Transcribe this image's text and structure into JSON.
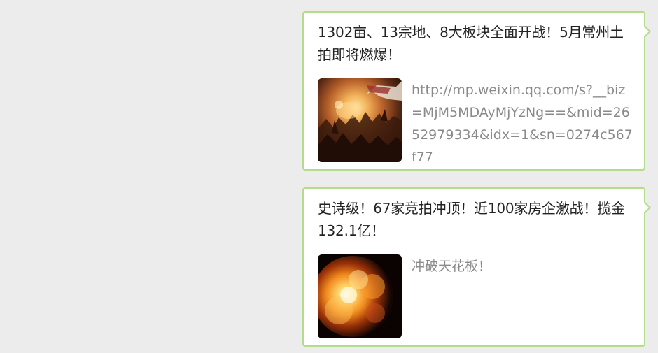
{
  "messages": [
    {
      "title": "1302亩、13宗地、8大板块全面开战！5月常州土拍即将燃爆！",
      "description": "http://mp.weixin.qq.com/s?__biz=MjM5MDAyMjYzNg==&mid=2652979334&idx=1&sn=0274c567f77",
      "thumbnail": "battle-painting-thumbnail"
    },
    {
      "title": "史诗级！67家竞拍冲顶！近100家房企激战！揽金132.1亿！",
      "description": "冲破天花板！",
      "thumbnail": "fire-explosion-thumbnail"
    }
  ],
  "colors": {
    "background": "#ececec",
    "bubble_border": "#b3dd8a",
    "title_text": "#222222",
    "description_text": "#8a8a8a"
  }
}
